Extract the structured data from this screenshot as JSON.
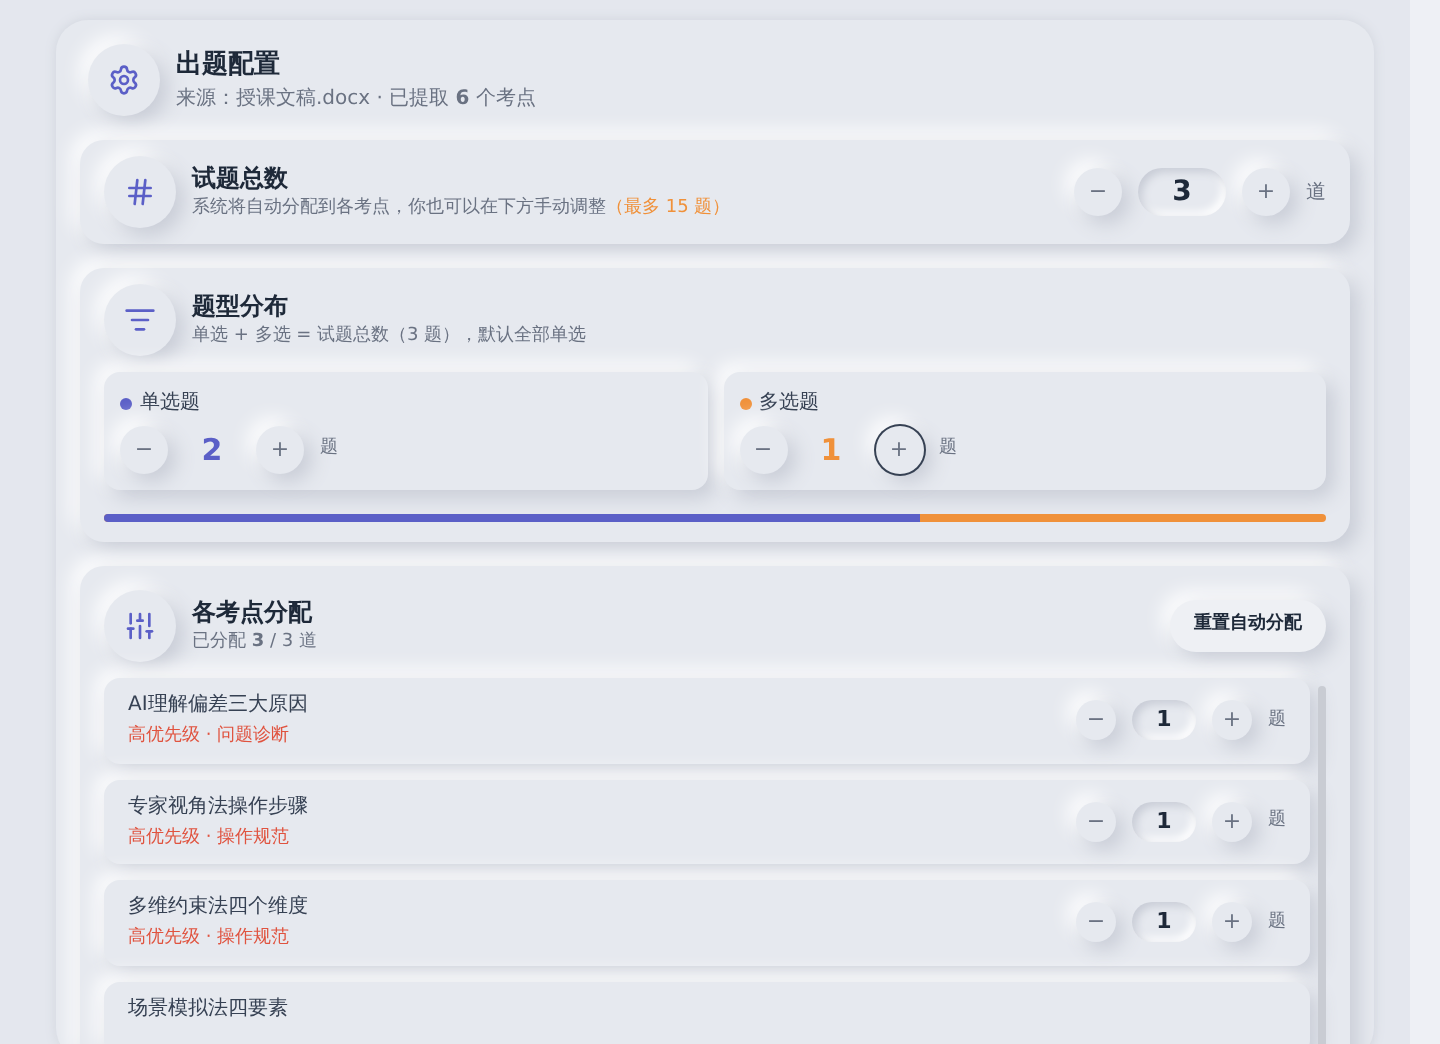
{
  "header": {
    "title": "出题配置",
    "subtitle": "来源：授课文稿.docx · 已提取 **6** 个考点"
  },
  "total": {
    "title": "试题总数",
    "description": "系统将自动分配到各考点，你也可以在下方手动调整",
    "limit": "（最多 15 题）",
    "minus": "−",
    "value": "3",
    "plus": "+",
    "unit": "道"
  },
  "distribution": {
    "title": "题型分布",
    "description": "单选 + 多选 = 试题总数（3 题），默认全部单选",
    "types": [
      {
        "label": "单选题",
        "color": "#5b5fc7",
        "minus": "−",
        "value": "2",
        "plus": "+",
        "plus_focused": false,
        "unit": "题"
      },
      {
        "label": "多选题",
        "color": "#f0913a",
        "minus": "−",
        "value": "1",
        "plus": "+",
        "plus_focused": true,
        "unit": "题"
      }
    ],
    "bar": {
      "level": 0.667
    }
  },
  "allocation": {
    "title": "各考点分配",
    "summary": "已分配 **3** / 3 道",
    "reset_button": "重置自动分配",
    "points": [
      {
        "name": "AI理解偏差三大原因",
        "tags": "高优先级 · 问题诊断",
        "minus": "−",
        "value": "1",
        "plus": "+",
        "unit": "题"
      },
      {
        "name": "专家视角法操作步骤",
        "tags": "高优先级 · 操作规范",
        "minus": "−",
        "value": "1",
        "plus": "+",
        "unit": "题"
      },
      {
        "name": "多维约束法四个维度",
        "tags": "高优先级 · 操作规范",
        "minus": "−",
        "value": "1",
        "plus": "+",
        "unit": "题"
      },
      {
        "name": "场景模拟法四要素"
      }
    ]
  }
}
